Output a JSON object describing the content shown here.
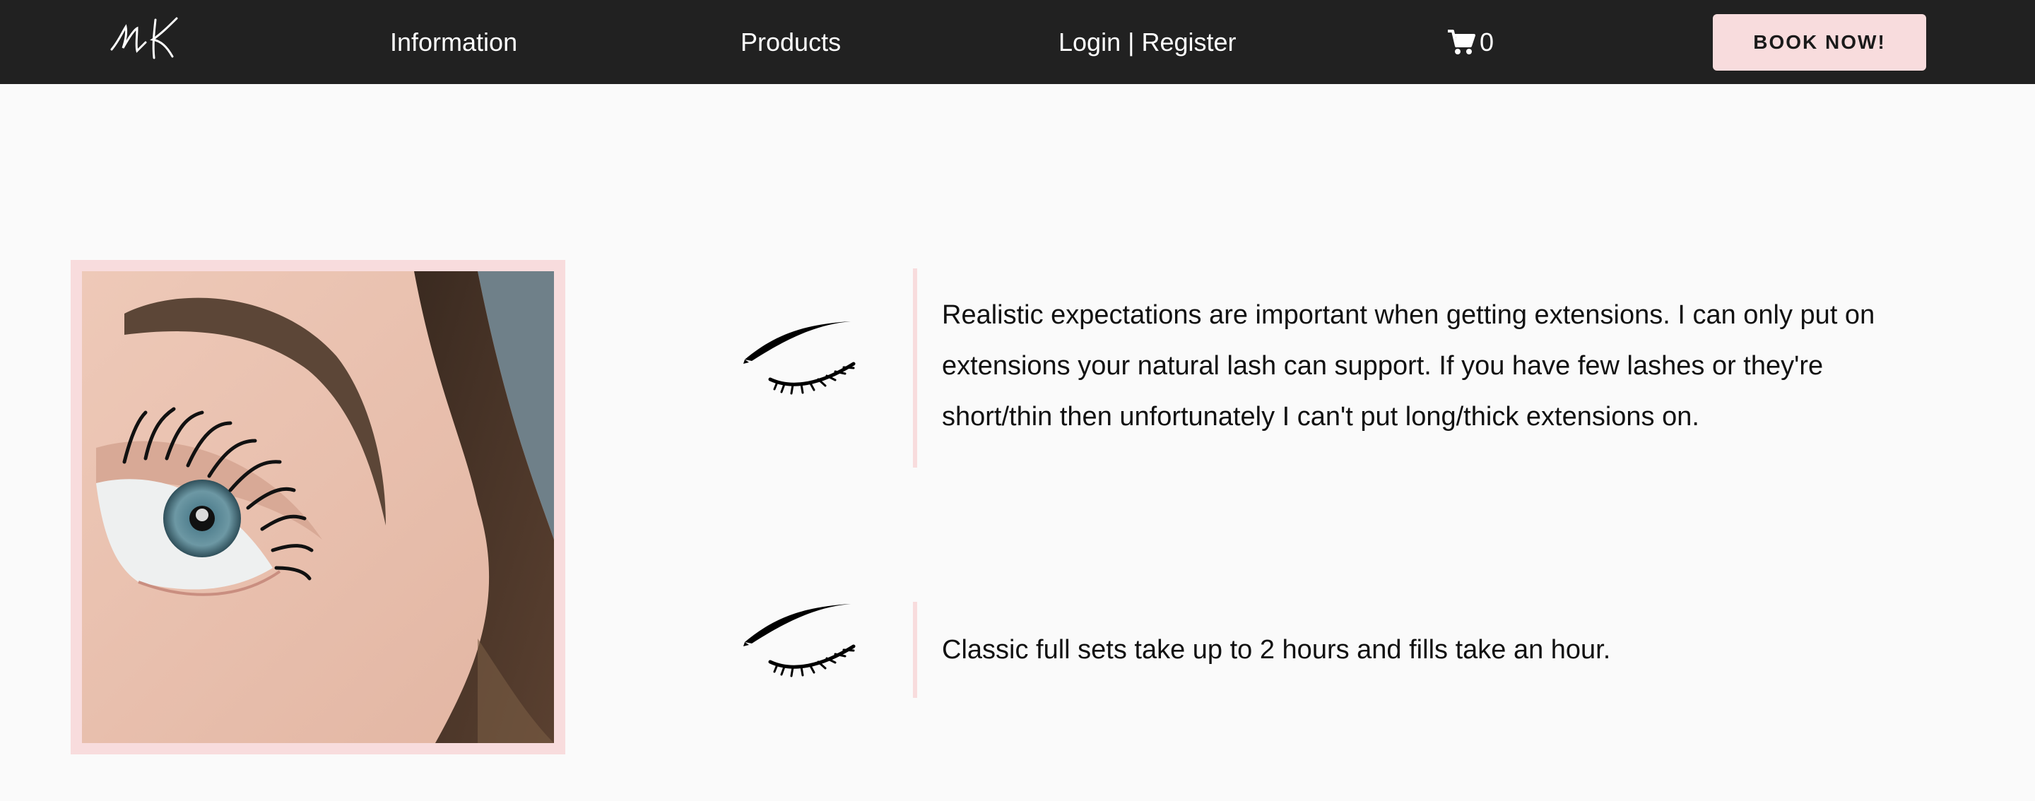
{
  "nav": {
    "logo_icon": "mk-signature-logo",
    "links": [
      "Information",
      "Products",
      "Login | Register"
    ],
    "cart": {
      "icon": "shopping-cart-icon",
      "count": "0"
    },
    "book_button": "BOOK NOW!"
  },
  "colors": {
    "navbar": "#212121",
    "accent_pink": "#f8dcdd",
    "background": "#fafafa",
    "text": "#111111"
  },
  "main": {
    "photo": {
      "icon": "lash-closeup-photo"
    },
    "items": [
      {
        "icon": "eyelash-icon",
        "text": "Realistic expectations are important when getting extensions. I can only put on extensions your natural lash can support. If you have few lashes or they're short/thin then unfortunately I can't put long/thick extensions on."
      },
      {
        "icon": "eyelash-icon",
        "text": "Classic full sets take up to 2 hours and fills take an hour."
      }
    ]
  }
}
